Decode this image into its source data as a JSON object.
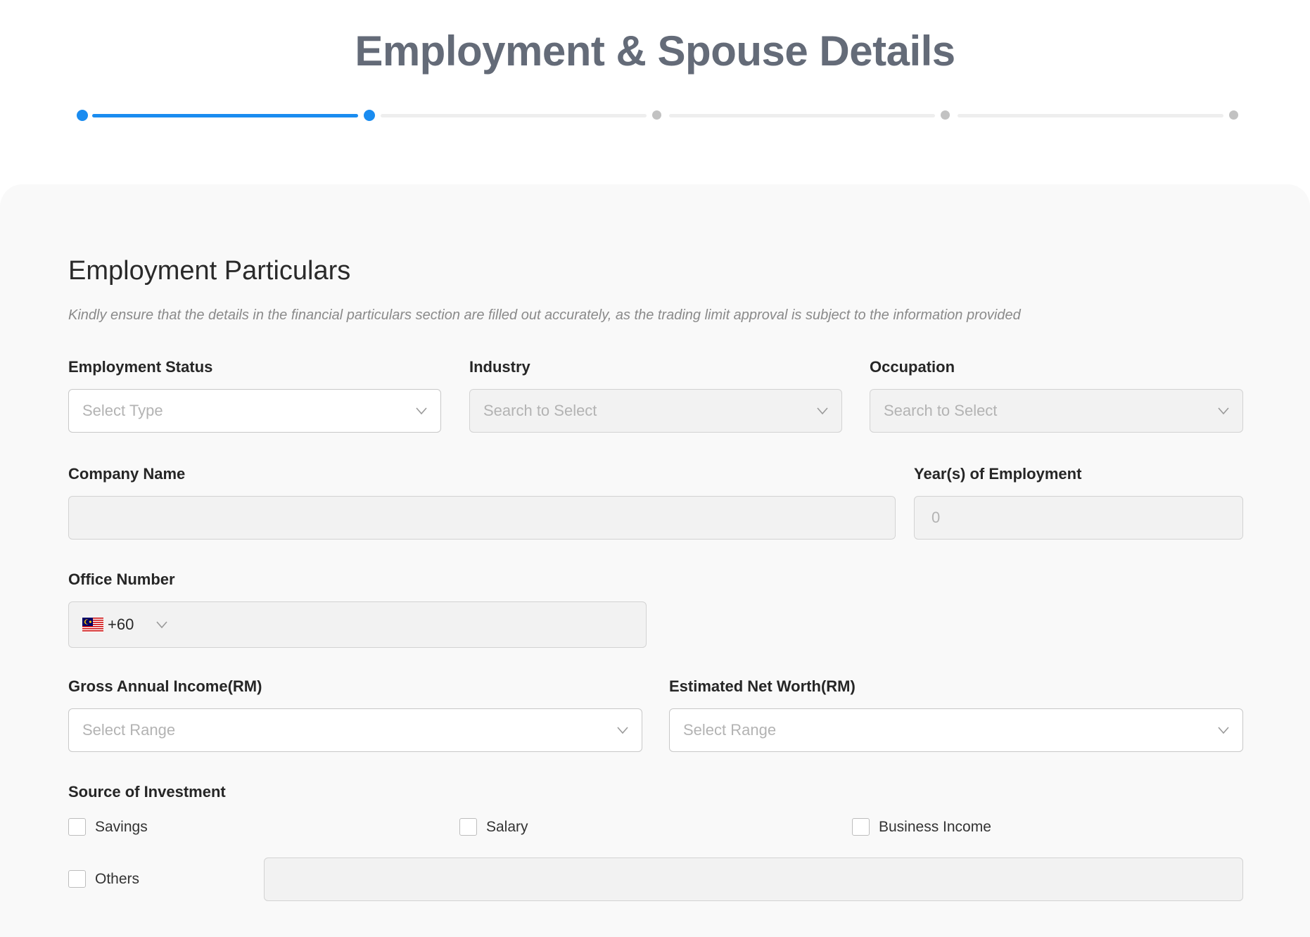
{
  "page": {
    "title": "Employment & Spouse Details",
    "stepper": {
      "total_steps": 5,
      "current_step": 2
    }
  },
  "section": {
    "title": "Employment Particulars",
    "description": "Kindly ensure that the details in the financial particulars section are filled out accurately, as the trading limit approval is subject to the information provided"
  },
  "fields": {
    "employment_status": {
      "label": "Employment Status",
      "placeholder": "Select Type"
    },
    "industry": {
      "label": "Industry",
      "placeholder": "Search to Select"
    },
    "occupation": {
      "label": "Occupation",
      "placeholder": "Search to Select"
    },
    "company_name": {
      "label": "Company Name",
      "value": ""
    },
    "years_of_employment": {
      "label": "Year(s) of Employment",
      "placeholder": "0"
    },
    "office_number": {
      "label": "Office Number",
      "country_code": "+60",
      "flag_icon": "malaysia-flag-icon",
      "value": ""
    },
    "gross_annual_income": {
      "label": "Gross Annual Income(RM)",
      "placeholder": "Select Range"
    },
    "estimated_net_worth": {
      "label": "Estimated Net Worth(RM)",
      "placeholder": "Select Range"
    },
    "source_of_investment": {
      "label": "Source of Investment",
      "options": [
        {
          "label": "Savings",
          "checked": false
        },
        {
          "label": "Salary",
          "checked": false
        },
        {
          "label": "Business Income",
          "checked": false
        },
        {
          "label": "Others",
          "checked": false
        }
      ],
      "others_value": ""
    }
  },
  "colors": {
    "accent": "#1a8cf0",
    "title": "#646b78",
    "placeholder": "#b3b3b3"
  }
}
